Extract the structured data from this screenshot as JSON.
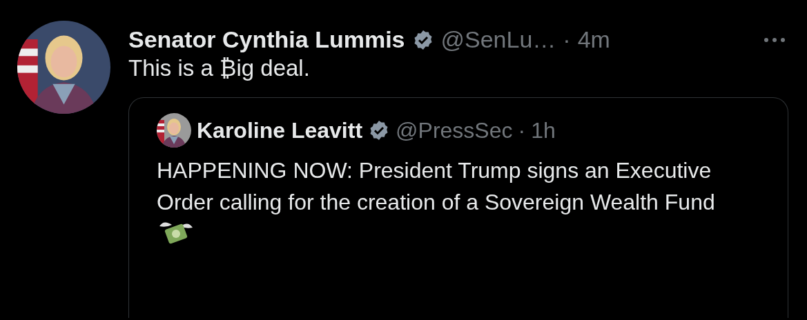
{
  "tweet": {
    "author": {
      "name": "Senator Cynthia Lummis",
      "verified": true,
      "handle": "@SenLu…",
      "separator": "·",
      "time": "4m"
    },
    "text": "This is a ₿ig deal.",
    "quote": {
      "author": {
        "name": "Karoline Leavitt",
        "verified": true,
        "handle": "@PressSec",
        "separator": "·",
        "time": "1h"
      },
      "text": "HAPPENING NOW: President Trump signs an Executive Order calling for the creation of a Sovereign Wealth Fund"
    }
  }
}
